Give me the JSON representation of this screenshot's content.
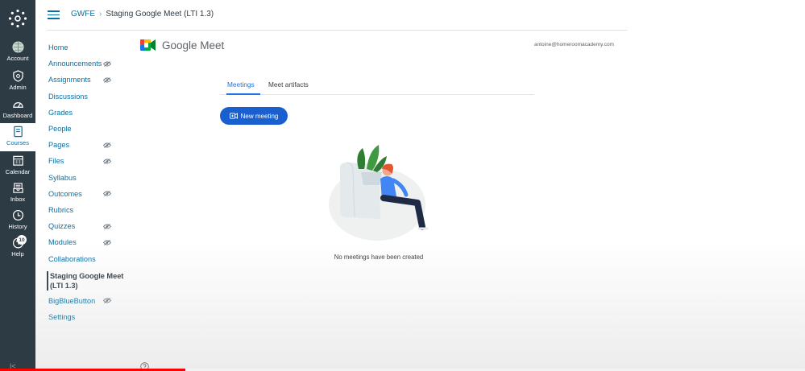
{
  "global_nav": {
    "items": [
      {
        "label": "Account",
        "icon": "avatar-icon"
      },
      {
        "label": "Admin",
        "icon": "shield-icon"
      },
      {
        "label": "Dashboard",
        "icon": "dashboard-icon"
      },
      {
        "label": "Courses",
        "icon": "book-icon"
      },
      {
        "label": "Calendar",
        "icon": "calendar-icon"
      },
      {
        "label": "Inbox",
        "icon": "inbox-icon"
      },
      {
        "label": "History",
        "icon": "clock-icon"
      },
      {
        "label": "Help",
        "icon": "help-icon",
        "badge": "10"
      }
    ],
    "active": "Courses"
  },
  "breadcrumb": {
    "course": "GWFE",
    "separator": "›",
    "current": "Staging Google Meet (LTI 1.3)"
  },
  "course_nav": {
    "items": [
      {
        "label": "Home",
        "hidden_icon": false
      },
      {
        "label": "Announcements",
        "hidden_icon": true
      },
      {
        "label": "Assignments",
        "hidden_icon": true
      },
      {
        "label": "Discussions",
        "hidden_icon": false
      },
      {
        "label": "Grades",
        "hidden_icon": false
      },
      {
        "label": "People",
        "hidden_icon": false
      },
      {
        "label": "Pages",
        "hidden_icon": true
      },
      {
        "label": "Files",
        "hidden_icon": true
      },
      {
        "label": "Syllabus",
        "hidden_icon": false
      },
      {
        "label": "Outcomes",
        "hidden_icon": true
      },
      {
        "label": "Rubrics",
        "hidden_icon": false
      },
      {
        "label": "Quizzes",
        "hidden_icon": true
      },
      {
        "label": "Modules",
        "hidden_icon": true
      },
      {
        "label": "Collaborations",
        "hidden_icon": false
      },
      {
        "label": "Staging Google Meet",
        "label_line2": "(LTI 1.3)",
        "hidden_icon": false,
        "active": true
      },
      {
        "label": "BigBlueButton",
        "hidden_icon": true
      },
      {
        "label": "Settings",
        "hidden_icon": false
      }
    ]
  },
  "meet": {
    "title": "Google Meet",
    "user_email": "antoine@homeroomacademy.com",
    "tabs": [
      {
        "label": "Meetings",
        "active": true
      },
      {
        "label": "Meet artifacts",
        "active": false
      }
    ],
    "new_meeting_label": "New meeting",
    "empty_message": "No meetings have been created"
  },
  "video_progress": 0.23,
  "colors": {
    "nav_bg": "#2d3b45",
    "link": "#0770a3",
    "google_blue": "#1a73e8",
    "button": "#1a5fcf"
  }
}
